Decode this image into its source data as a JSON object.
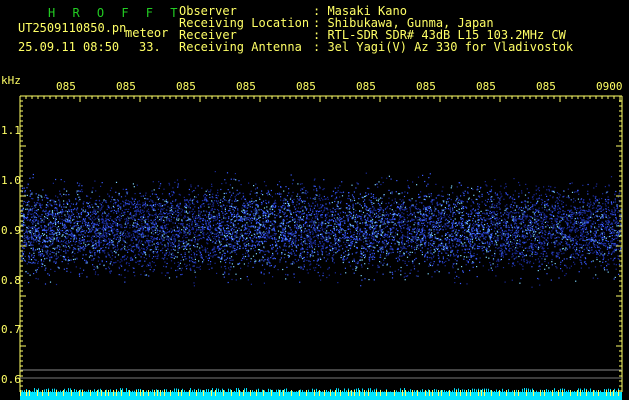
{
  "header": {
    "brand": "H R O F F T",
    "filename": "UT2509110850.pn",
    "mode": "meteor",
    "datetime": "25.09.11 08:50",
    "count": "33.",
    "labels": [
      "Observer",
      "Receiving Location",
      "Receiver",
      "Receiving Antenna"
    ],
    "values": [
      ": Masaki Kano",
      ": Shibukawa, Gunma, Japan",
      ": RTL-SDR SDR# 43dB L15 103.2MHz CW",
      ": 3el Yagi(V) Az 330 for Vladivostok"
    ]
  },
  "axes": {
    "y_unit": "kHz",
    "y_ticks": [
      "1.1",
      "1.0",
      "0.9",
      "0.8",
      "0.7",
      "0.6"
    ],
    "x_ticks": [
      "085",
      "085",
      "085",
      "085",
      "085",
      "085",
      "085",
      "085",
      "085",
      "0900"
    ]
  },
  "colors": {
    "text": "#ffff66",
    "brand": "#22cc22",
    "tick": "#ffff66",
    "signal_bright": "#7fd8ff",
    "signal_dim": "#1a2a9a",
    "baseline": "#00e5ff"
  }
}
